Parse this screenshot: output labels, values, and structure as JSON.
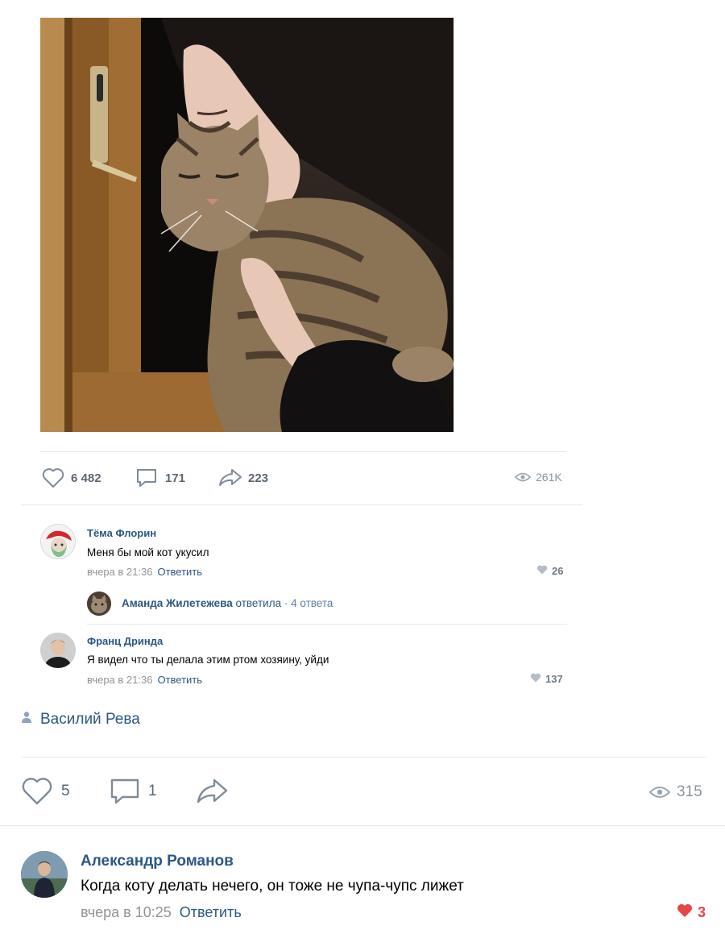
{
  "inner_post": {
    "stats": {
      "likes": "6 482",
      "comments": "171",
      "shares": "223",
      "views": "261K"
    },
    "comments": [
      {
        "author": "Тёма Флорин",
        "text": "Меня бы мой кот укусил",
        "time": "вчера в 21:36",
        "reply_label": "Ответить",
        "likes": "26"
      },
      {
        "author": "Франц Дринда",
        "text": "Я видел что ты делала этим ртом хозяину, уйди",
        "time": "вчера в 21:36",
        "reply_label": "Ответить",
        "likes": "137"
      }
    ],
    "replies_summary": {
      "author": "Аманда Жилетежева",
      "verb": "ответила",
      "count": "· 4 ответа"
    }
  },
  "repost_author": "Василий Рева",
  "outer_post": {
    "stats": {
      "likes": "5",
      "comments": "1",
      "views": "315"
    },
    "comment": {
      "author": "Александр Романов",
      "text": "Когда коту делать нечего, он тоже не чупа-чупс лижет",
      "time": "вчера в 10:25",
      "reply_label": "Ответить",
      "likes": "3"
    }
  },
  "colors": {
    "link": "#2a5885",
    "icon": "#6f7a86",
    "like_active": "#e64646",
    "meta": "#939393",
    "divider": "#e7e8ec"
  },
  "icons": [
    "heart-icon",
    "comment-icon",
    "share-icon",
    "eye-icon",
    "user-icon"
  ]
}
